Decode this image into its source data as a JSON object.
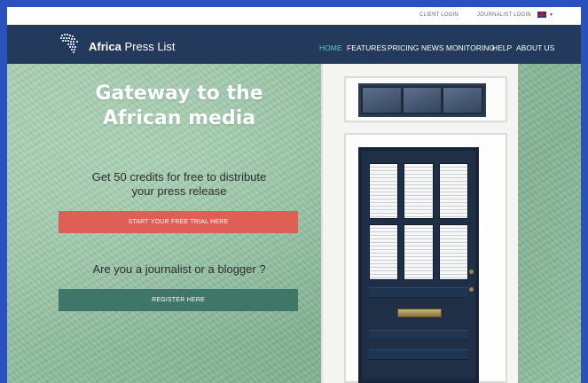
{
  "topbar": {
    "client_login": "CLIENT LOGIN",
    "journalist_login": "JOURNALIST LOGIN",
    "language_icon": "uk-flag-icon"
  },
  "navbar": {
    "brand_bold": "Africa",
    "brand_rest": " Press List",
    "logo_icon": "africa-map-logo",
    "items": [
      {
        "label": "HOME",
        "active": true
      },
      {
        "label": "FEATURES",
        "active": false
      },
      {
        "label": "PRICING",
        "active": false
      },
      {
        "label": "NEWS MONITORING",
        "active": false
      },
      {
        "label": "HELP",
        "active": false
      },
      {
        "label": "ABOUT US",
        "active": false
      }
    ]
  },
  "hero": {
    "title_line1": "Gateway to the",
    "title_line2": "African media",
    "subtitle_line1": "Get 50 credits for free to distribute",
    "subtitle_line2": "your press release",
    "trial_button": "START YOUR FREE TRIAL HERE",
    "journalist_question": "Are you a journalist or a blogger ?",
    "register_button": "REGISTER HERE"
  },
  "colors": {
    "page_border": "#2a52be",
    "navbar": "#243a5c",
    "nav_active": "#4fd1c5",
    "trial_button": "#df5e55",
    "register_button": "#3f7668",
    "wall": "#8fbd9d",
    "door": "#1f2f45"
  }
}
